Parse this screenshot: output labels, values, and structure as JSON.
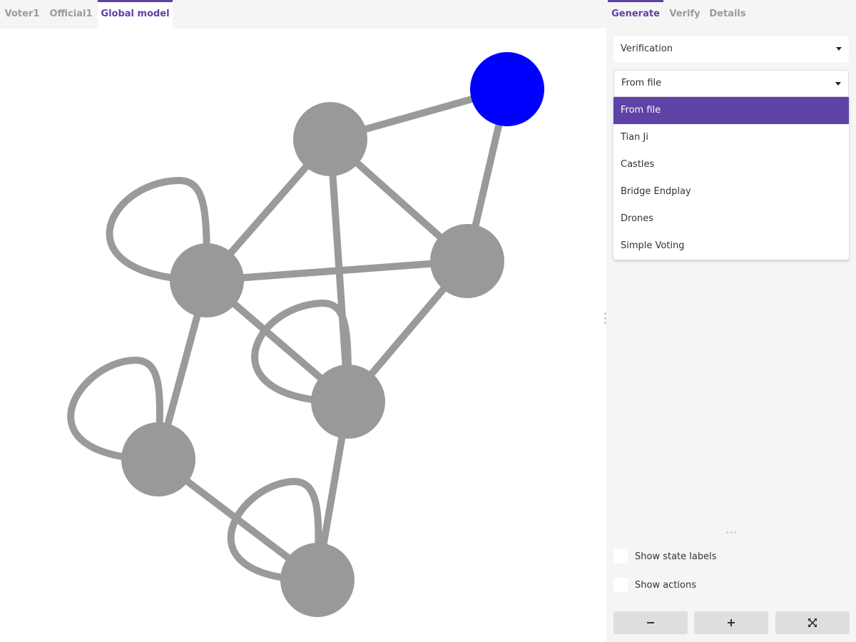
{
  "left_tabs": [
    {
      "label": "Voter1",
      "active": false
    },
    {
      "label": "Official1",
      "active": false
    },
    {
      "label": "Global model",
      "active": true
    }
  ],
  "right_tabs": [
    {
      "label": "Generate",
      "active": true
    },
    {
      "label": "Verify",
      "active": false
    },
    {
      "label": "Details",
      "active": false
    }
  ],
  "generate": {
    "mode_select": {
      "value": "Verification"
    },
    "model_select": {
      "value": "From file",
      "options": [
        "From file",
        "Tian Ji",
        "Castles",
        "Bridge Endplay",
        "Drones",
        "Simple Voting"
      ],
      "selected_index": 0
    }
  },
  "options": {
    "show_state_labels": {
      "label": "Show state labels",
      "checked": false
    },
    "show_actions": {
      "label": "Show actions",
      "checked": false
    }
  },
  "zoom_buttons": {
    "zoom_out": "minus-icon",
    "zoom_in": "plus-icon",
    "fit": "fit-screen-icon"
  },
  "colors": {
    "accent": "#5e42a6",
    "initial_state": "#0000ff",
    "state": "#999999",
    "edge": "#9a9a9a"
  }
}
